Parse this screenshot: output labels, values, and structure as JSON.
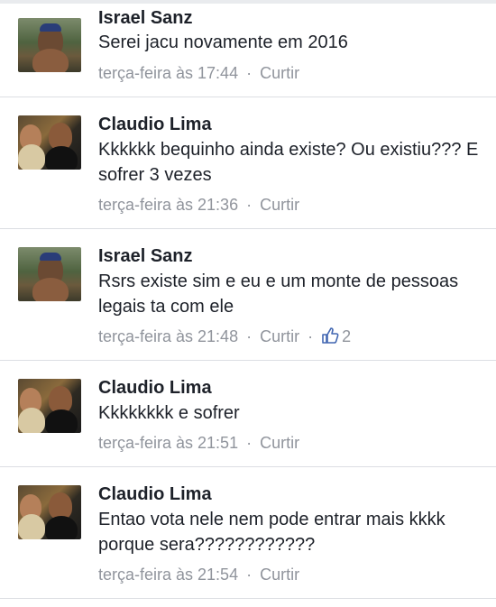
{
  "comments": [
    {
      "author": "Israel Sanz",
      "text": "Serei jacu novamente em 2016",
      "time": "terça-feira às 17:44",
      "separator": "·",
      "like_label": "Curtir",
      "likes": ""
    },
    {
      "author": "Claudio Lima",
      "text": "Kkkkkk bequinho ainda existe? Ou existiu??? E sofrer 3 vezes",
      "time": "terça-feira às 21:36",
      "separator": "·",
      "like_label": "Curtir",
      "likes": ""
    },
    {
      "author": "Israel Sanz",
      "text": "Rsrs existe sim e eu e um monte de pessoas legais ta com ele",
      "time": "terça-feira às 21:48",
      "separator": "·",
      "like_label": "Curtir",
      "likes": "2"
    },
    {
      "author": "Claudio Lima",
      "text": "Kkkkkkkk e sofrer",
      "time": "terça-feira às 21:51",
      "separator": "·",
      "like_label": "Curtir",
      "likes": ""
    },
    {
      "author": "Claudio Lima",
      "text": "Entao vota nele nem pode entrar mais kkkk porque sera????????????",
      "time": "terça-feira às 21:54",
      "separator": "·",
      "like_label": "Curtir",
      "likes": ""
    }
  ],
  "colors": {
    "author": "#1d2129",
    "meta": "#90949c",
    "thumb": "#4267b2",
    "divider": "#dcdee3"
  },
  "icons": {
    "like_count": "thumbs-up-icon"
  }
}
